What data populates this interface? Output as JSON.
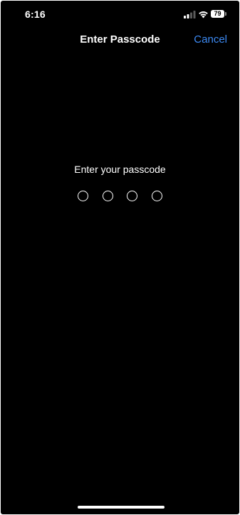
{
  "status_bar": {
    "time": "6:16",
    "signal_icon": "cellular-signal-icon",
    "wifi_icon": "wifi-icon",
    "battery_level": "79"
  },
  "nav": {
    "title": "Enter Passcode",
    "cancel_label": "Cancel"
  },
  "passcode": {
    "prompt": "Enter your passcode",
    "digit_count": 4,
    "entered_count": 0
  },
  "colors": {
    "background": "#000000",
    "text": "#ffffff",
    "accent": "#3d8bf5"
  }
}
